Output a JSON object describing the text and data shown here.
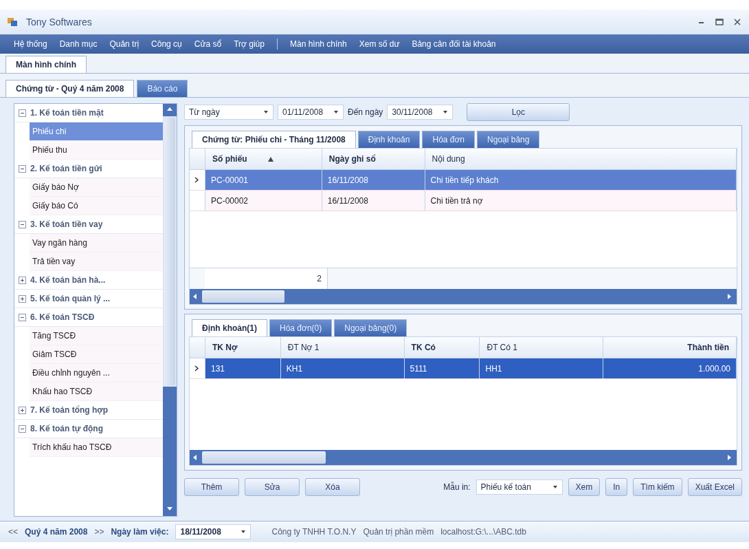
{
  "window": {
    "title": "Tony Softwares"
  },
  "menu": [
    {
      "label": "Hệ thống"
    },
    {
      "label": "Danh mục"
    },
    {
      "label": "Quản trị"
    },
    {
      "label": "Công cụ"
    },
    {
      "label": "Cửa sổ"
    },
    {
      "label": "Trợ giúp"
    }
  ],
  "shortcuts": [
    {
      "label": "Màn hình chính"
    },
    {
      "label": "Xem số dư"
    },
    {
      "label": "Bảng cân đối tài khoản"
    }
  ],
  "main_tabs": [
    {
      "label": "Màn hình chính",
      "selected": true
    }
  ],
  "section_tabs": [
    {
      "label": "Chứng từ - Quý 4 năm 2008",
      "selected": true
    },
    {
      "label": "Báo cáo",
      "selected": false
    }
  ],
  "tree": [
    {
      "label": "1. Kế toán tiền mặt",
      "expanded": true,
      "children": [
        {
          "label": "Phiếu chi",
          "selected": true
        },
        {
          "label": "Phiếu thu",
          "selected": false
        }
      ]
    },
    {
      "label": "2. Kế toán tiền gửi",
      "expanded": true,
      "children": [
        {
          "label": "Giấy báo Nợ",
          "selected": false
        },
        {
          "label": "Giấy báo Có",
          "selected": false
        }
      ]
    },
    {
      "label": "3. Kế toán tiền vay",
      "expanded": true,
      "children": [
        {
          "label": "Vay ngân hàng",
          "selected": false
        },
        {
          "label": "Trả tiền vay",
          "selected": false
        }
      ]
    },
    {
      "label": "4. Kế toán bán hà...",
      "expanded": false
    },
    {
      "label": "5. Kế toán quản lý ...",
      "expanded": false
    },
    {
      "label": "6. Kế toán TSCĐ",
      "expanded": true,
      "children": [
        {
          "label": "Tăng TSCĐ",
          "selected": false
        },
        {
          "label": "Giảm TSCĐ",
          "selected": false
        },
        {
          "label": "Điều chỉnh nguyên ...",
          "selected": false
        },
        {
          "label": "Khấu hao TSCĐ",
          "selected": false
        }
      ]
    },
    {
      "label": "7. Kế toán tổng hợp",
      "expanded": false
    },
    {
      "label": "8. Kế toán tự động",
      "expanded": true,
      "children": [
        {
          "label": "Trích khấu hao TSCĐ",
          "selected": false
        }
      ]
    }
  ],
  "filter": {
    "period": "Từ ngày",
    "from": "01/11/2008",
    "to_label": "Đến ngày",
    "to": "30/11/2008",
    "button": "Lọc"
  },
  "doc_tabs": [
    {
      "label": "Chứng từ: Phiếu chi - Tháng 11/2008",
      "selected": true
    },
    {
      "label": "Định khoản",
      "selected": false
    },
    {
      "label": "Hóa đơn",
      "selected": false
    },
    {
      "label": "Ngoại bảng",
      "selected": false
    }
  ],
  "doc_table": {
    "columns": [
      {
        "label": "Số phiếu",
        "bold": true,
        "sorted": true
      },
      {
        "label": "Ngày ghi sổ",
        "bold": true,
        "sorted": false
      },
      {
        "label": "Nội dung",
        "bold": false,
        "sorted": false
      }
    ],
    "rows": [
      {
        "cells": [
          "PC-00001",
          "16/11/2008",
          "Chi tiền tiếp khách"
        ],
        "selected": true
      },
      {
        "cells": [
          "PC-00002",
          "16/11/2008",
          "Chi tiền trả nợ"
        ],
        "selected": false
      }
    ],
    "count": "2"
  },
  "detail_tabs": [
    {
      "label": "Định khoản(1)",
      "selected": true
    },
    {
      "label": "Hóa đơn(0)",
      "selected": false
    },
    {
      "label": "Ngoại bảng(0)",
      "selected": false
    }
  ],
  "detail_table": {
    "columns": [
      {
        "label": "TK Nợ",
        "bold": true,
        "numeric": false
      },
      {
        "label": "ĐT Nợ 1",
        "bold": false,
        "numeric": false
      },
      {
        "label": "TK Có",
        "bold": true,
        "numeric": false
      },
      {
        "label": "ĐT Có 1",
        "bold": false,
        "numeric": false
      },
      {
        "label": "Thành tiền",
        "bold": true,
        "numeric": true
      }
    ],
    "rows": [
      {
        "cells": [
          "131",
          "KH1",
          "5111",
          "HH1",
          "1.000.00"
        ],
        "selected": true
      }
    ]
  },
  "actions": {
    "left": [
      "Thêm",
      "Sửa",
      "Xóa"
    ],
    "template_label": "Mẫu in:",
    "template": "Phiếu kế toán",
    "right": [
      "Xem",
      "In",
      "Tìm kiếm",
      "Xuất Excel"
    ]
  },
  "status_bar": {
    "prev": "<<",
    "period": "Quý 4 năm 2008",
    "next": ">>",
    "workday_label": "Ngày làm việc:",
    "workday": "18/11/2008",
    "company": "Công ty TNHH T.O.N.Y",
    "role": "Quản trị phần mềm",
    "path": "localhost:G:\\...\\ABC.tdb"
  }
}
